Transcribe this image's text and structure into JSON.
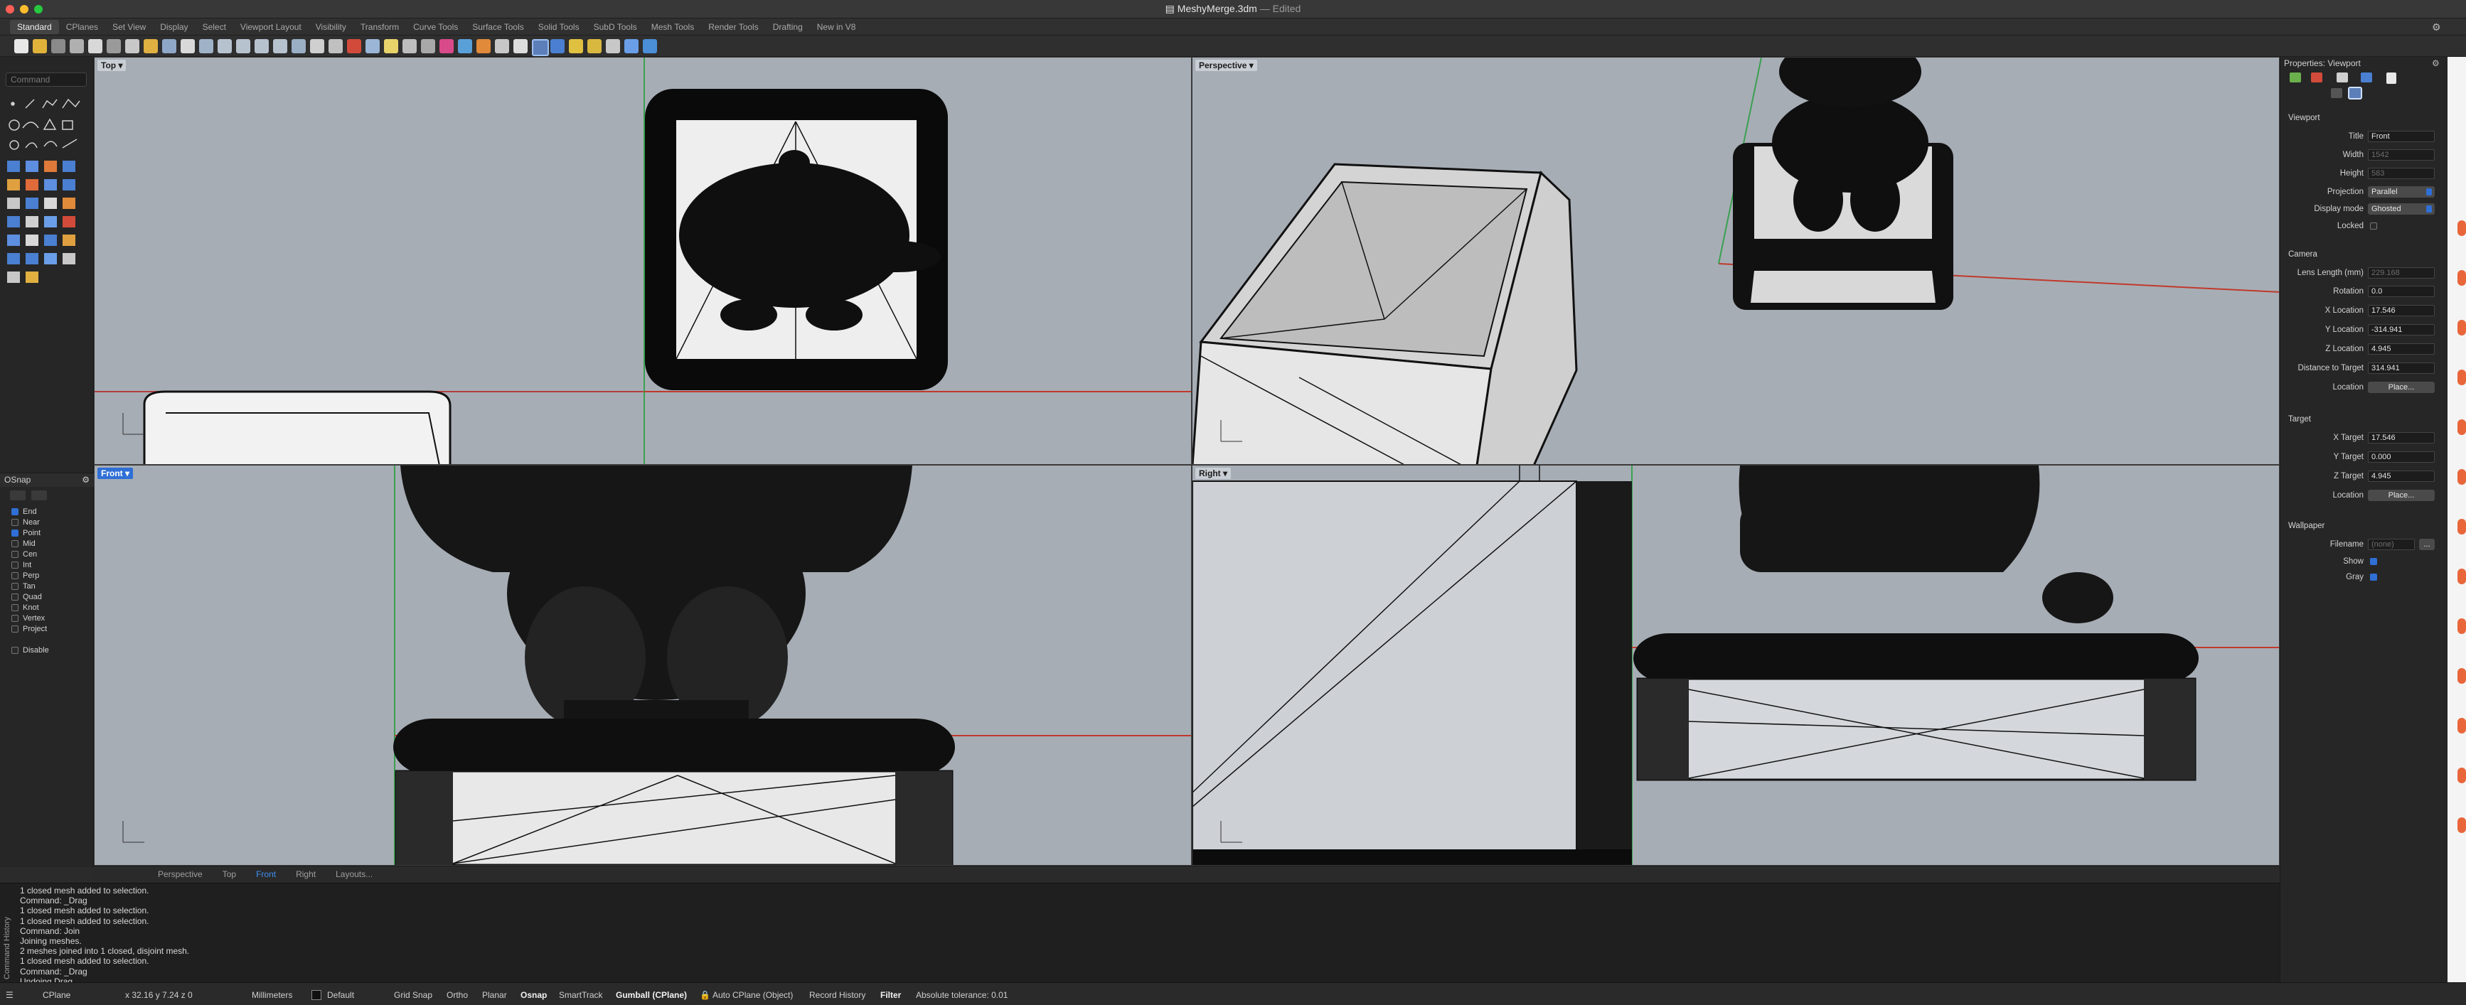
{
  "window": {
    "file_name": "MeshyMerge.3dm",
    "separator": "—",
    "state": "Edited"
  },
  "tabs": [
    "Standard",
    "CPlanes",
    "Set View",
    "Display",
    "Select",
    "Viewport Layout",
    "Visibility",
    "Transform",
    "Curve Tools",
    "Surface Tools",
    "Solid Tools",
    "SubD Tools",
    "Mesh Tools",
    "Render Tools",
    "Drafting",
    "New in V8"
  ],
  "command_placeholder": "Command",
  "osnap": {
    "title": "OSnap",
    "items": [
      {
        "label": "End",
        "checked": true
      },
      {
        "label": "Near",
        "checked": false
      },
      {
        "label": "Point",
        "checked": true
      },
      {
        "label": "Mid",
        "checked": false
      },
      {
        "label": "Cen",
        "checked": false
      },
      {
        "label": "Int",
        "checked": false
      },
      {
        "label": "Perp",
        "checked": false
      },
      {
        "label": "Tan",
        "checked": false
      },
      {
        "label": "Quad",
        "checked": false
      },
      {
        "label": "Knot",
        "checked": false
      },
      {
        "label": "Vertex",
        "checked": false
      },
      {
        "label": "Project",
        "checked": false
      }
    ],
    "disable_label": "Disable"
  },
  "viewports": {
    "top": "Top",
    "perspective": "Perspective",
    "front": "Front",
    "right": "Right"
  },
  "viewport_tabs": [
    "Perspective",
    "Top",
    "Front",
    "Right",
    "Layouts..."
  ],
  "history": {
    "side_label": "Command History",
    "lines": [
      "1 closed mesh added to selection.",
      "Command: _Drag",
      "1 closed mesh added to selection.",
      "1 closed mesh added to selection.",
      "Command: Join",
      "Joining meshes.",
      "2 meshes joined into 1 closed, disjoint mesh.",
      "1 closed mesh added to selection.",
      "Command: _Drag",
      "Undoing Drag"
    ]
  },
  "status": {
    "cplane": "CPlane",
    "coords": "x 32.16  y 7.24  z 0",
    "units": "Millimeters",
    "layer": "Default",
    "grid_snap": "Grid Snap",
    "ortho": "Ortho",
    "planar": "Planar",
    "osnap": "Osnap",
    "smarttrack": "SmartTrack",
    "gumball": "Gumball (CPlane)",
    "autocplane": "Auto CPlane (Object)",
    "record_history": "Record History",
    "filter": "Filter",
    "tolerance": "Absolute tolerance: 0.01"
  },
  "properties": {
    "title": "Properties: Viewport",
    "viewport_section": "Viewport",
    "title_label": "Title",
    "title_value": "Front",
    "width_label": "Width",
    "width_value": "1542",
    "height_label": "Height",
    "height_value": "583",
    "projection_label": "Projection",
    "projection_value": "Parallel",
    "display_label": "Display mode",
    "display_value": "Ghosted",
    "locked_label": "Locked",
    "camera_section": "Camera",
    "lens_label": "Lens Length (mm)",
    "lens_value": "229.168",
    "rotation_label": "Rotation",
    "rotation_value": "0.0",
    "xloc_label": "X Location",
    "xloc_value": "17.546",
    "yloc_label": "Y Location",
    "yloc_value": "-314.941",
    "zloc_label": "Z Location",
    "zloc_value": "4.945",
    "dist_label": "Distance to Target",
    "dist_value": "314.941",
    "location_label": "Location",
    "place_label": "Place...",
    "target_section": "Target",
    "xt_label": "X Target",
    "xt_value": "17.546",
    "yt_label": "Y Target",
    "yt_value": "0.000",
    "zt_label": "Z Target",
    "zt_value": "4.945",
    "wallpaper_section": "Wallpaper",
    "filename_label": "Filename",
    "filename_value": "(none)",
    "show_label": "Show",
    "gray_label": "Gray",
    "browse_label": "..."
  },
  "colors": {
    "accent": "#2f6fd6",
    "viewport_bg": "#a7adb5",
    "x_axis": "#c0392b",
    "y_axis": "#27a844"
  }
}
